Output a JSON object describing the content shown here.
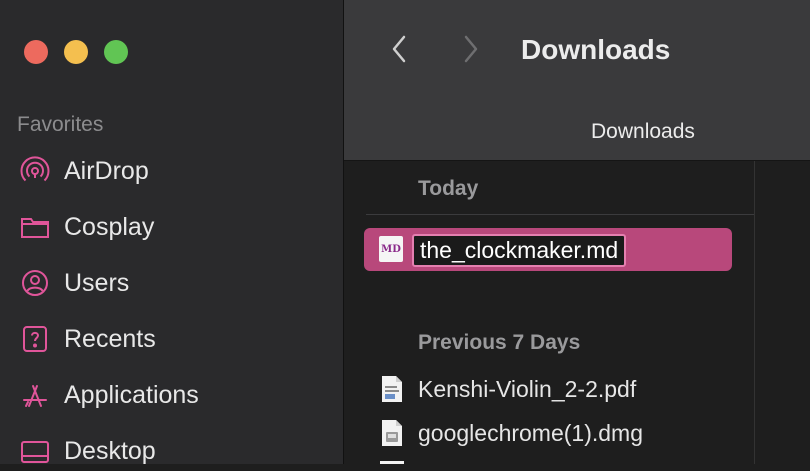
{
  "sidebar": {
    "section_label": "Favorites",
    "accent": "#e0559a",
    "items": [
      {
        "label": "AirDrop",
        "icon": "airdrop-icon"
      },
      {
        "label": "Cosplay",
        "icon": "folder-icon"
      },
      {
        "label": "Users",
        "icon": "user-icon"
      },
      {
        "label": "Recents",
        "icon": "recents-icon"
      },
      {
        "label": "Applications",
        "icon": "applications-icon"
      },
      {
        "label": "Desktop",
        "icon": "desktop-icon"
      }
    ]
  },
  "toolbar": {
    "title": "Downloads",
    "tab_label": "Downloads"
  },
  "content": {
    "sections": [
      {
        "header": "Today"
      },
      {
        "header": "Previous 7 Days"
      }
    ],
    "selected_file": {
      "name": "the_clockmaker.md",
      "icon_text": "MD"
    },
    "files": [
      {
        "name": "Kenshi-Violin_2-2.pdf",
        "icon": "pdf-file-icon"
      },
      {
        "name": "googlechrome(1).dmg",
        "icon": "dmg-file-icon"
      }
    ]
  }
}
